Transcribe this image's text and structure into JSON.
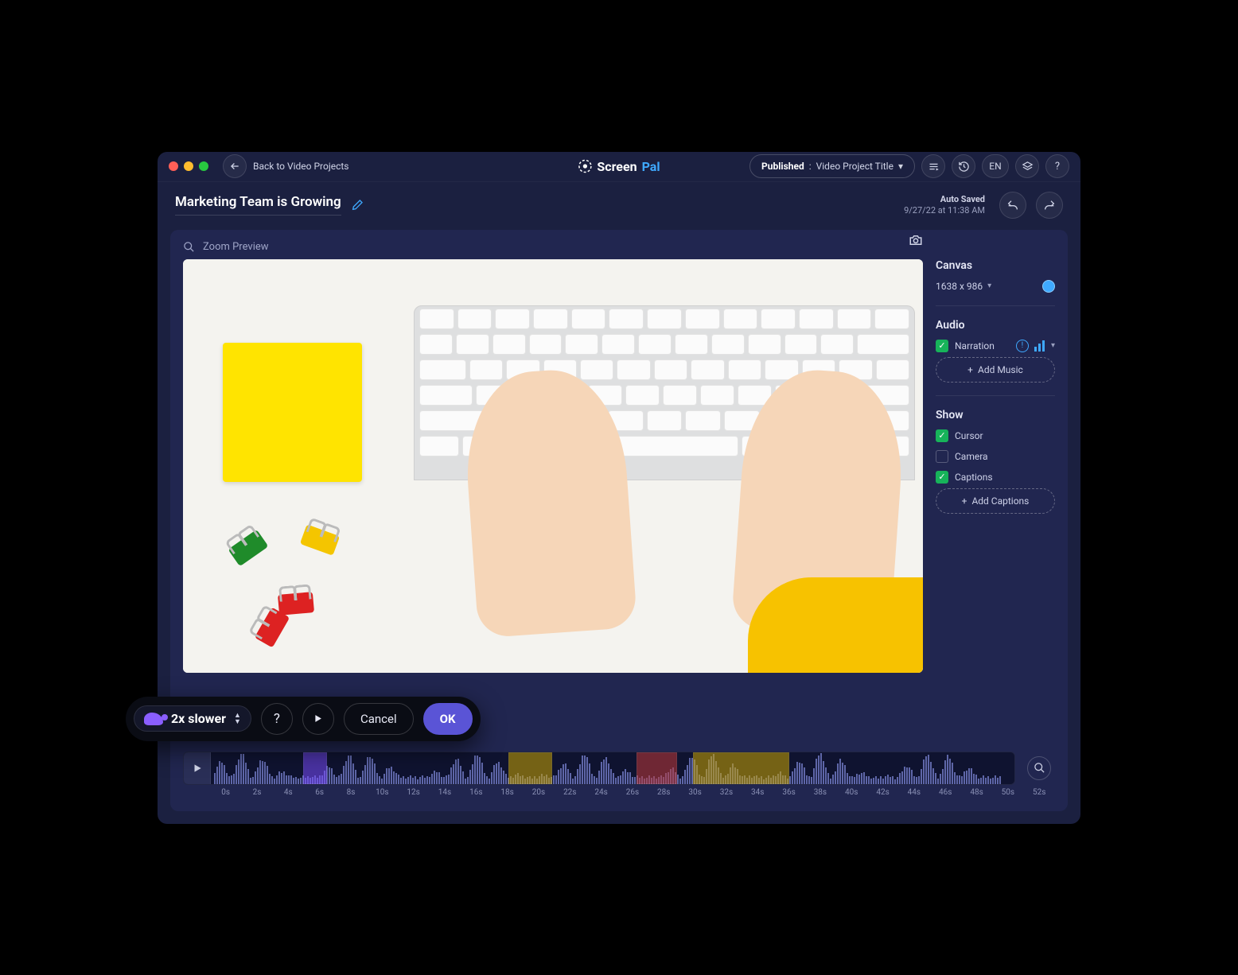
{
  "topbar": {
    "back_label": "Back to Video Projects",
    "brand_a": "Screen",
    "brand_b": "Pal",
    "publish_status": "Published",
    "publish_title": "Video Project Title",
    "lang": "EN"
  },
  "project": {
    "title": "Marketing Team is Growing",
    "autosave_label": "Auto Saved",
    "autosave_time": "9/27/22 at 11:38 AM"
  },
  "preview": {
    "zoom_label": "Zoom Preview"
  },
  "panel": {
    "canvas": {
      "heading": "Canvas",
      "dimensions": "1638 x 986",
      "bg_color": "#3fa9ff"
    },
    "audio": {
      "heading": "Audio",
      "narration_label": "Narration",
      "narration_checked": true,
      "add_music": "Add Music"
    },
    "show": {
      "heading": "Show",
      "cursor_label": "Cursor",
      "cursor_checked": true,
      "camera_label": "Camera",
      "camera_checked": false,
      "captions_label": "Captions",
      "captions_checked": true,
      "add_captions": "Add Captions"
    }
  },
  "timeline": {
    "ticks": [
      "0s",
      "2s",
      "4s",
      "6s",
      "8s",
      "10s",
      "12s",
      "14s",
      "16s",
      "18s",
      "20s",
      "22s",
      "24s",
      "26s",
      "28s",
      "30s",
      "32s",
      "34s",
      "36s",
      "38s",
      "40s",
      "42s",
      "44s",
      "46s",
      "48s",
      "50s",
      "52s"
    ],
    "regions": [
      {
        "type": "purple",
        "start_pct": 11.5,
        "width_pct": 3
      },
      {
        "type": "yellow",
        "start_pct": 37,
        "width_pct": 5.5
      },
      {
        "type": "red",
        "start_pct": 53,
        "width_pct": 5
      },
      {
        "type": "yellow",
        "start_pct": 60,
        "width_pct": 12
      }
    ]
  },
  "toolbar": {
    "speed_label": "2x slower",
    "cancel": "Cancel",
    "ok": "OK"
  }
}
